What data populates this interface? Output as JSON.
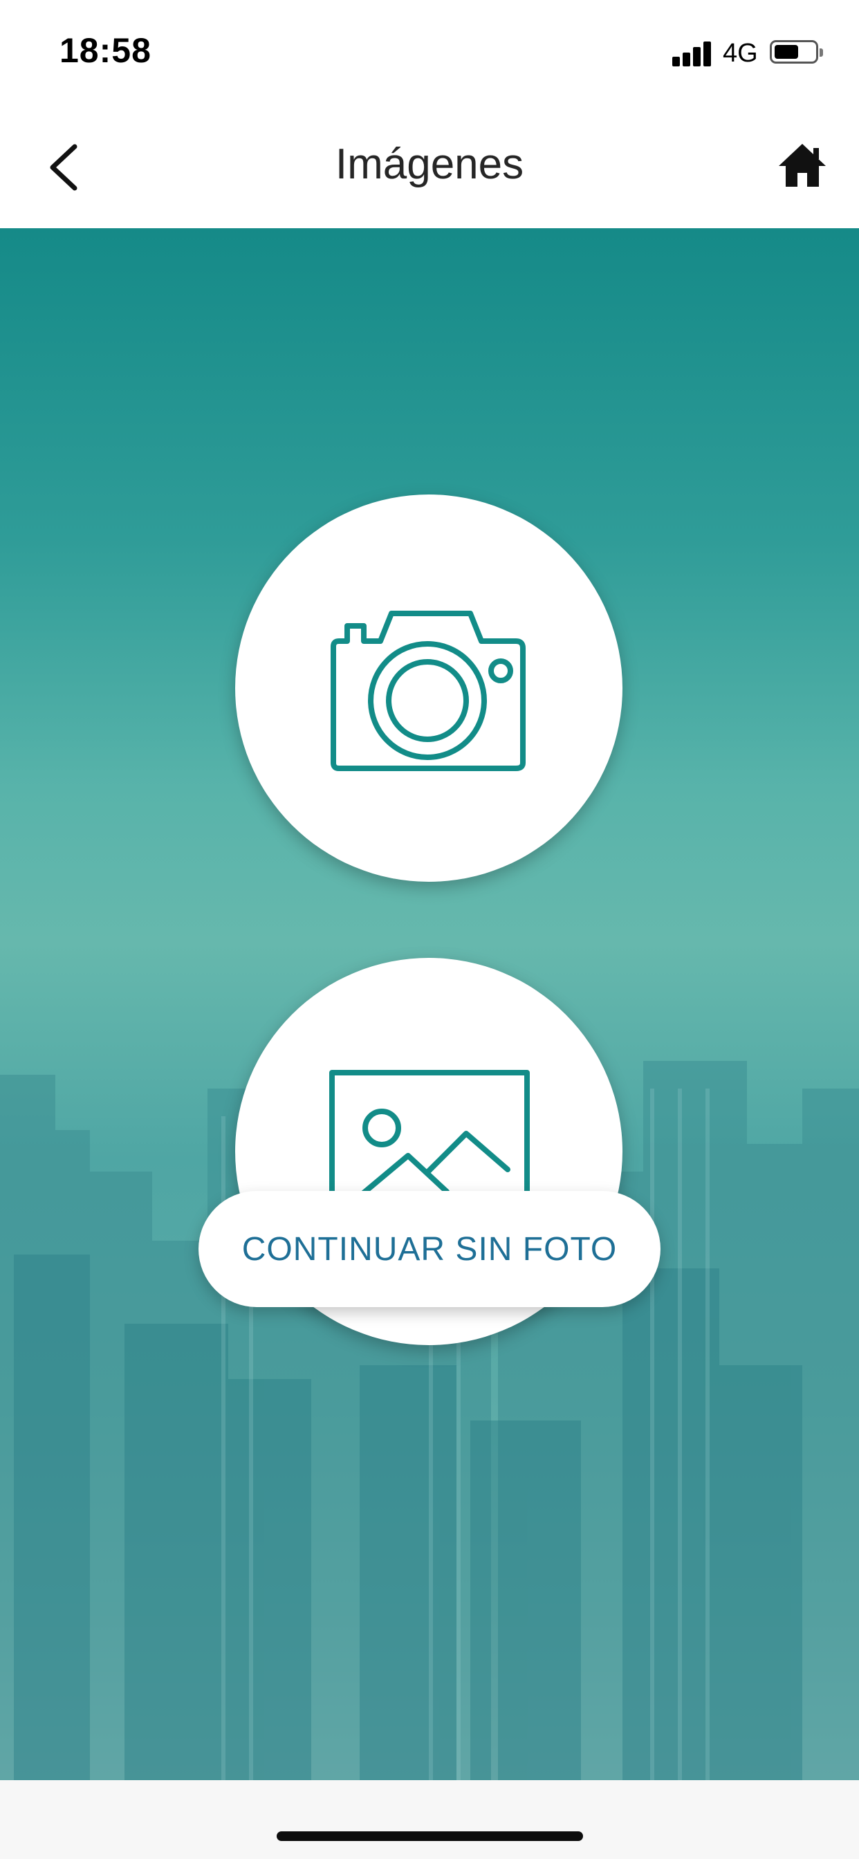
{
  "status_bar": {
    "time": "18:58",
    "network": "4G",
    "signal_icon": "cellular-signal-icon",
    "battery_icon": "battery-icon",
    "battery_level": 0.55
  },
  "nav": {
    "title": "Imágenes",
    "back_icon": "chevron-left-icon",
    "home_icon": "home-icon"
  },
  "actions": {
    "camera_icon": "camera-icon",
    "gallery_icon": "image-gallery-icon",
    "continue_label": "CONTINUAR SIN FOTO"
  },
  "colors": {
    "accent": "#128c88",
    "button_text": "#1e6f96",
    "background_top": "#158a88"
  }
}
